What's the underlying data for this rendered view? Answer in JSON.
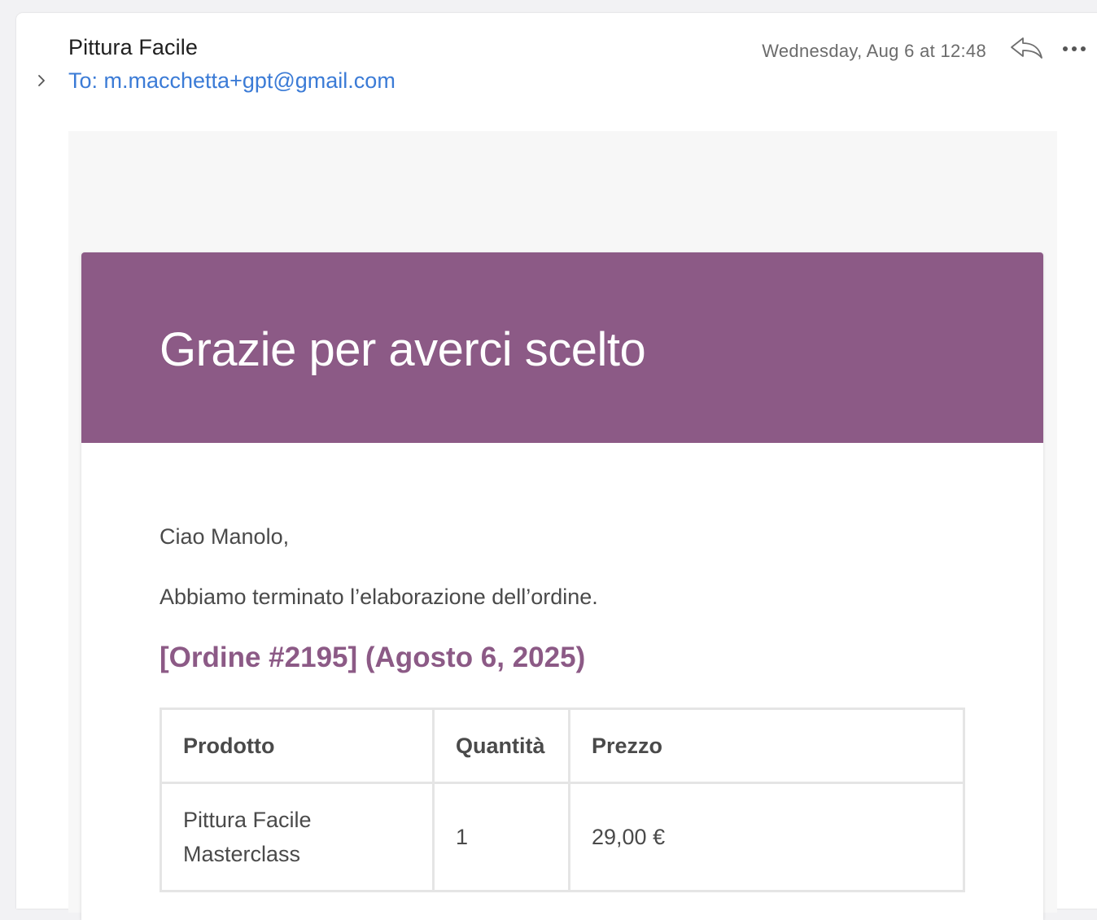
{
  "header": {
    "sender": "Pittura Facile",
    "recipient": "To: m.macchetta+gpt@gmail.com",
    "timestamp": "Wednesday, Aug 6 at 12:48"
  },
  "icons": {
    "expand": "chevron-right-icon",
    "reply": "reply-icon",
    "more": "ellipsis-icon"
  },
  "email": {
    "title": "Grazie per averci scelto",
    "greeting": "Ciao Manolo,",
    "message": "Abbiamo terminato l’elaborazione dell’ordine.",
    "order_heading": "[Ordine #2195] (Agosto 6, 2025)",
    "table": {
      "headers": [
        "Prodotto",
        "Quantità",
        "Prezzo"
      ],
      "rows": [
        {
          "product_line1": "Pittura Facile",
          "product_line2": "Masterclass",
          "quantity": "1",
          "price": "29,00 €"
        }
      ]
    }
  },
  "colors": {
    "accent": "#8c5a86",
    "link": "#3b7bd6",
    "body_bg": "#f7f7f7"
  }
}
